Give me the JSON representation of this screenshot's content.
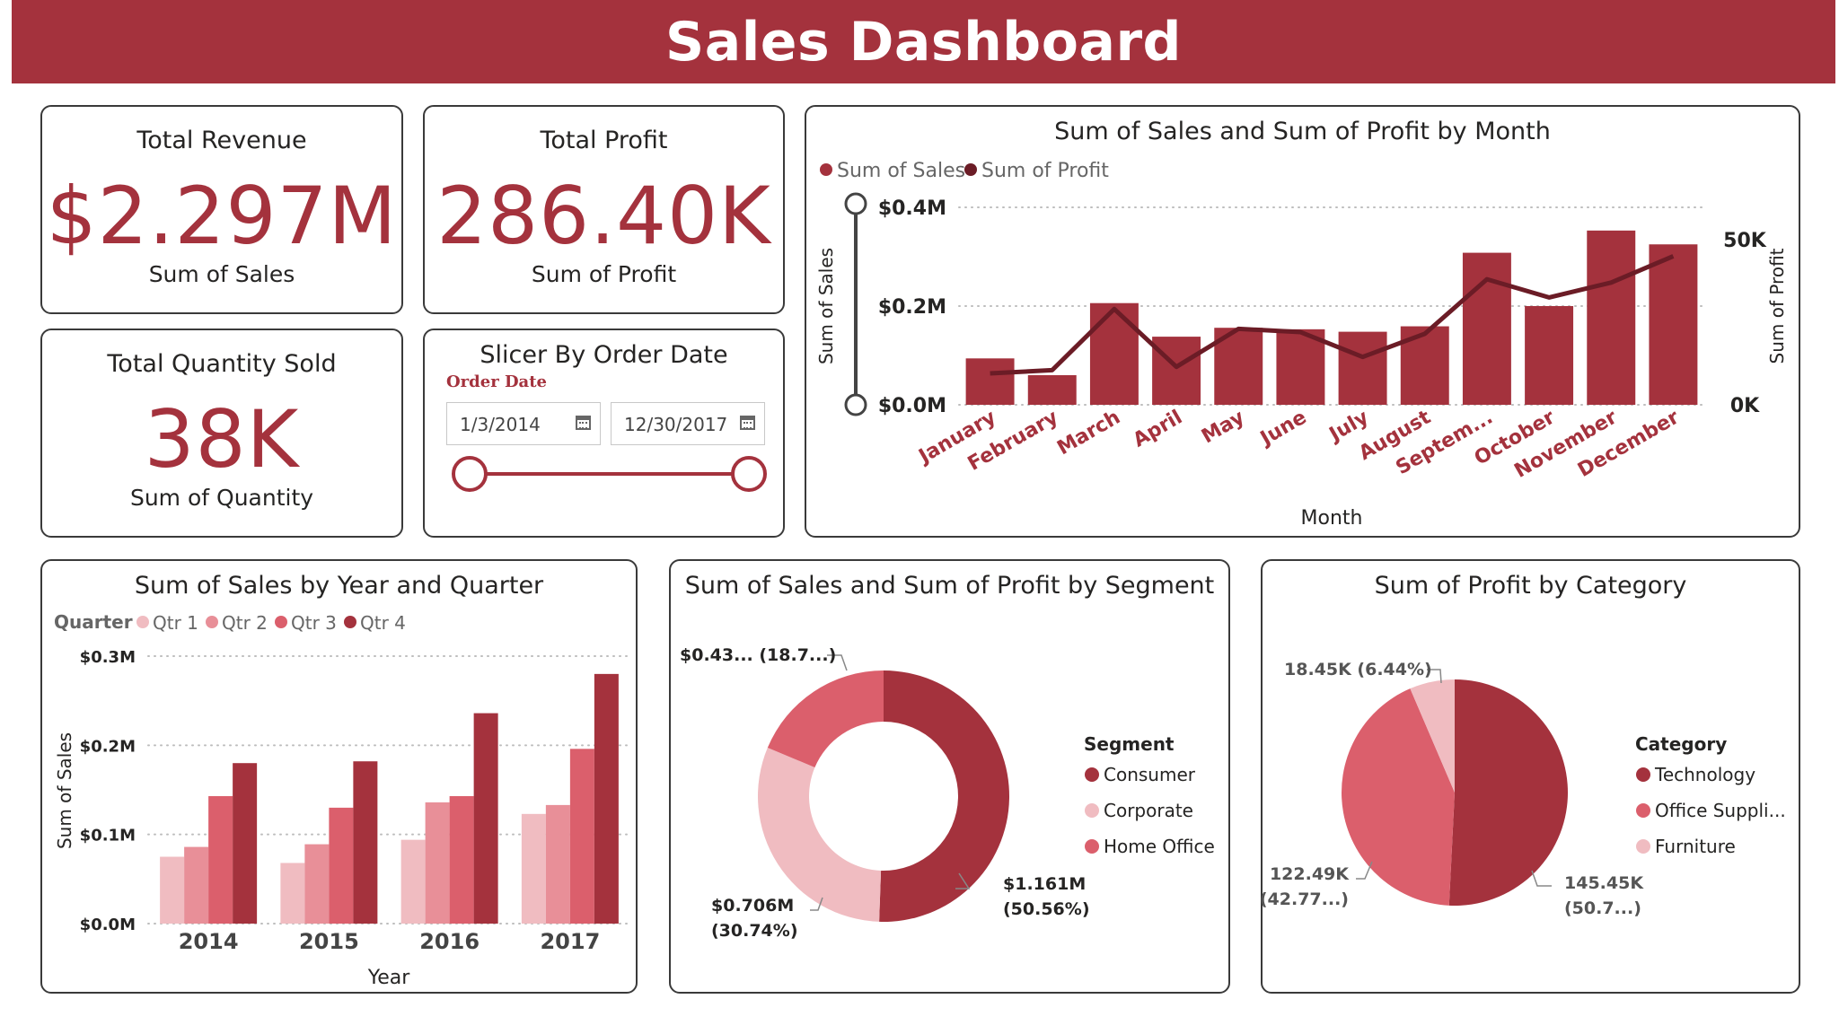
{
  "header": {
    "title": "Sales Dashboard"
  },
  "kpis": {
    "revenue": {
      "title": "Total Revenue",
      "value": "$2.297M",
      "caption": "Sum of Sales"
    },
    "profit": {
      "title": "Total Profit",
      "value": "286.40K",
      "caption": "Sum of Profit"
    },
    "quantity": {
      "title": "Total Quantity Sold",
      "value": "38K",
      "caption": "Sum of Quantity"
    }
  },
  "slicer": {
    "title": "Slicer By Order Date",
    "label": "Order Date",
    "start": "1/3/2014",
    "end": "12/30/2017",
    "range_fraction": [
      0,
      1
    ]
  },
  "colors": {
    "accent": "#a4323d",
    "dark_line": "#6b1c26",
    "qtr1": "#f0bcc1",
    "qtr2": "#e88f98",
    "qtr3": "#db5f6c",
    "qtr4": "#a4323d"
  },
  "chart_data": [
    {
      "id": "monthly",
      "type": "bar+line",
      "title": "Sum of Sales and Sum of Profit by Month",
      "xlabel": "Month",
      "ylabel": "Sum of Sales",
      "y2label": "Sum of Profit",
      "categories": [
        "January",
        "February",
        "March",
        "April",
        "May",
        "June",
        "July",
        "August",
        "Septem...",
        "October",
        "November",
        "December"
      ],
      "series": [
        {
          "name": "Sum of Sales",
          "type": "bar",
          "axis": "left",
          "color": "#a4323d",
          "values": [
            0.094,
            0.06,
            0.206,
            0.138,
            0.156,
            0.153,
            0.148,
            0.159,
            0.308,
            0.2,
            0.353,
            0.325
          ]
        },
        {
          "name": "Sum of Profit",
          "type": "line",
          "axis": "right",
          "color": "#6b1c26",
          "values": [
            9500,
            10500,
            29000,
            11500,
            23000,
            22000,
            14500,
            21500,
            38000,
            32500,
            37000,
            45000
          ]
        }
      ],
      "y_ticks": [
        "$0.0M",
        "$0.2M",
        "$0.4M"
      ],
      "y2_ticks": [
        "0K",
        "50K"
      ],
      "ylim": [
        0,
        0.4
      ],
      "y2lim": [
        0,
        50000
      ],
      "legend": "top-left",
      "grid": true
    },
    {
      "id": "yearly",
      "type": "bar",
      "title": "Sum of Sales by Year and Quarter",
      "xlabel": "Year",
      "ylabel": "Sum of Sales",
      "legend_title": "Quarter",
      "categories": [
        "2014",
        "2015",
        "2016",
        "2017"
      ],
      "series": [
        {
          "name": "Qtr 1",
          "color": "#f0bcc1",
          "values": [
            0.075,
            0.068,
            0.094,
            0.123
          ]
        },
        {
          "name": "Qtr 2",
          "color": "#e88f98",
          "values": [
            0.086,
            0.089,
            0.136,
            0.133
          ]
        },
        {
          "name": "Qtr 3",
          "color": "#db5f6c",
          "values": [
            0.143,
            0.13,
            0.143,
            0.196
          ]
        },
        {
          "name": "Qtr 4",
          "color": "#a4323d",
          "values": [
            0.18,
            0.182,
            0.236,
            0.28
          ]
        }
      ],
      "y_ticks": [
        "$0.0M",
        "$0.1M",
        "$0.2M",
        "$0.3M"
      ],
      "ylim": [
        0,
        0.3
      ],
      "legend": "top-left",
      "grid": true
    },
    {
      "id": "segment",
      "type": "donut",
      "title": "Sum of Sales and Sum of Profit by Segment",
      "legend_title": "Segment",
      "slices": [
        {
          "name": "Consumer",
          "value": 50.56,
          "color": "#a4323d",
          "label_value": "$1.161M",
          "label_pct": "(50.56%)"
        },
        {
          "name": "Corporate",
          "value": 30.74,
          "color": "#f0bcc1",
          "label_value": "$0.706M",
          "label_pct": "(30.74%)"
        },
        {
          "name": "Home Office",
          "value": 18.7,
          "color": "#db5f6c",
          "label_value": "$0.43... (18.7...)",
          "label_pct": ""
        }
      ],
      "legend": "right"
    },
    {
      "id": "category",
      "type": "pie",
      "title": "Sum of Profit by Category",
      "legend_title": "Category",
      "slices": [
        {
          "name": "Technology",
          "value": 50.79,
          "color": "#a4323d",
          "label_value": "145.45K",
          "label_pct": "(50.7...)"
        },
        {
          "name": "Office Suppli...",
          "value": 42.77,
          "color": "#db5f6c",
          "label_value": "122.49K",
          "label_pct": "(42.77...)"
        },
        {
          "name": "Furniture",
          "value": 6.44,
          "color": "#f0bcc1",
          "label_value": "18.45K (6.44%)",
          "label_pct": ""
        }
      ],
      "legend": "right"
    }
  ]
}
